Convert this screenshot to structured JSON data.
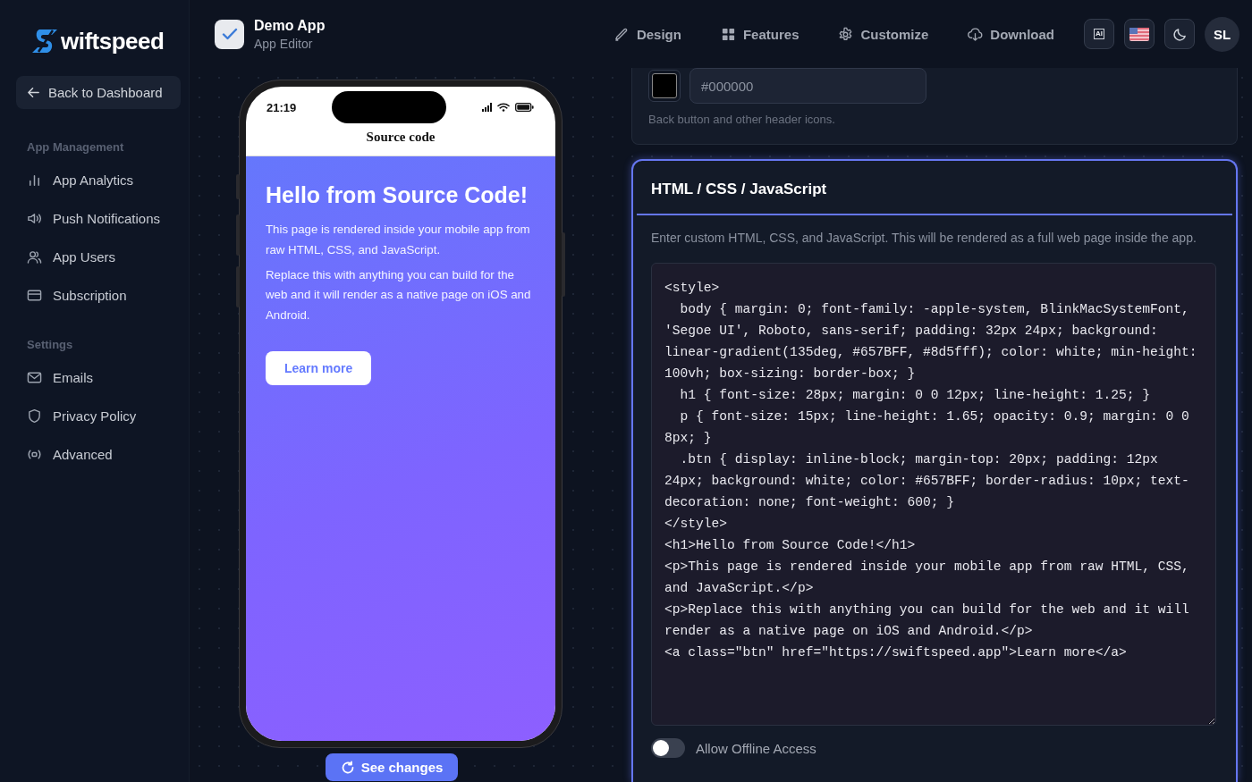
{
  "brand": {
    "name": "wiftspeed"
  },
  "sidebar": {
    "back_button": "Back to Dashboard",
    "sections": [
      {
        "title": "App Management",
        "items": [
          {
            "label": "App Analytics",
            "kind": "analytics"
          },
          {
            "label": "Push Notifications",
            "kind": "speaker"
          },
          {
            "label": "App Users",
            "kind": "users"
          },
          {
            "label": "Subscription",
            "kind": "card"
          }
        ]
      },
      {
        "title": "Settings",
        "items": [
          {
            "label": "Emails",
            "kind": "mail"
          },
          {
            "label": "Privacy Policy",
            "kind": "shield"
          },
          {
            "label": "Advanced",
            "kind": "broadcast"
          }
        ]
      }
    ]
  },
  "header": {
    "app_name": "Demo App",
    "app_subtitle": "App Editor",
    "nav": [
      {
        "label": "Design",
        "kind": "brush"
      },
      {
        "label": "Features",
        "kind": "grid"
      },
      {
        "label": "Customize",
        "kind": "gear"
      },
      {
        "label": "Download",
        "kind": "cloud"
      }
    ],
    "chip_label": "AI",
    "avatar": "SL"
  },
  "phone": {
    "time": "21:19",
    "title": "Source code",
    "heading": "Hello from Source Code!",
    "paragraphs": [
      "This page is rendered inside your mobile app from raw HTML, CSS, and JavaScript.",
      "Replace this with anything you can build for the web and it will render as a native page on iOS and Android."
    ],
    "button": "Learn more"
  },
  "see_changes_button": "See changes",
  "color_setting": {
    "color": "#000000",
    "value": "#000000",
    "hint": "Back button and other header icons."
  },
  "code_panel": {
    "title": "HTML / CSS / JavaScript",
    "description": "Enter custom HTML, CSS, and JavaScript. This will be rendered as a full web page inside the app.",
    "code": "<style>\n  body { margin: 0; font-family: -apple-system, BlinkMacSystemFont, 'Segoe UI', Roboto, sans-serif; padding: 32px 24px; background: linear-gradient(135deg, #657BFF, #8d5fff); color: white; min-height: 100vh; box-sizing: border-box; }\n  h1 { font-size: 28px; margin: 0 0 12px; line-height: 1.25; }\n  p { font-size: 15px; line-height: 1.65; opacity: 0.9; margin: 0 0 8px; }\n  .btn { display: inline-block; margin-top: 20px; padding: 12px 24px; background: white; color: #657BFF; border-radius: 10px; text-decoration: none; font-weight: 600; }\n</style>\n<h1>Hello from Source Code!</h1>\n<p>This page is rendered inside your mobile app from raw HTML, CSS, and JavaScript.</p>\n<p>Replace this with anything you can build for the web and it will render as a native page on iOS and Android.</p>\n<a class=\"btn\" href=\"https://swiftspeed.app\">Learn more</a>",
    "toggle": {
      "label": "Allow Offline Access",
      "on": false
    }
  }
}
